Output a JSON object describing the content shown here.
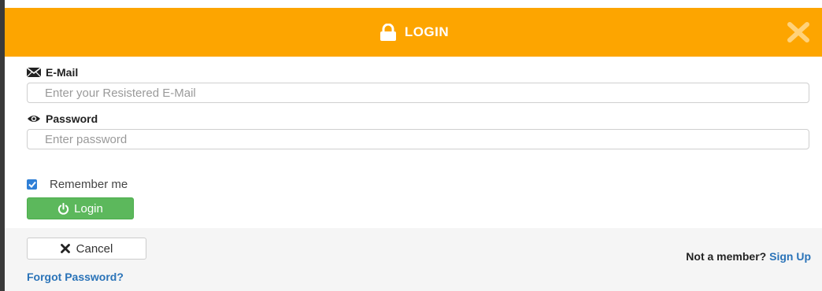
{
  "header": {
    "title": "LOGIN",
    "lock_icon": "lock-icon",
    "close_icon": "close-icon",
    "background": "#fda500"
  },
  "form": {
    "email": {
      "label": "E-Mail",
      "icon": "envelope-icon",
      "placeholder": "Enter your Resistered E-Mail",
      "value": ""
    },
    "password": {
      "label": "Password",
      "icon": "eye-icon",
      "placeholder": "Enter password",
      "value": ""
    },
    "remember": {
      "label": "Remember me",
      "checked": true
    },
    "login_button": {
      "label": "Login",
      "icon": "power-icon",
      "color": "#5cb85c"
    }
  },
  "footer": {
    "cancel_label": "Cancel",
    "cancel_icon": "x-icon",
    "forgot_label": "Forgot Password?",
    "signup_prompt": "Not a member?",
    "signup_link": "Sign Up",
    "link_color": "#2a73b8"
  }
}
